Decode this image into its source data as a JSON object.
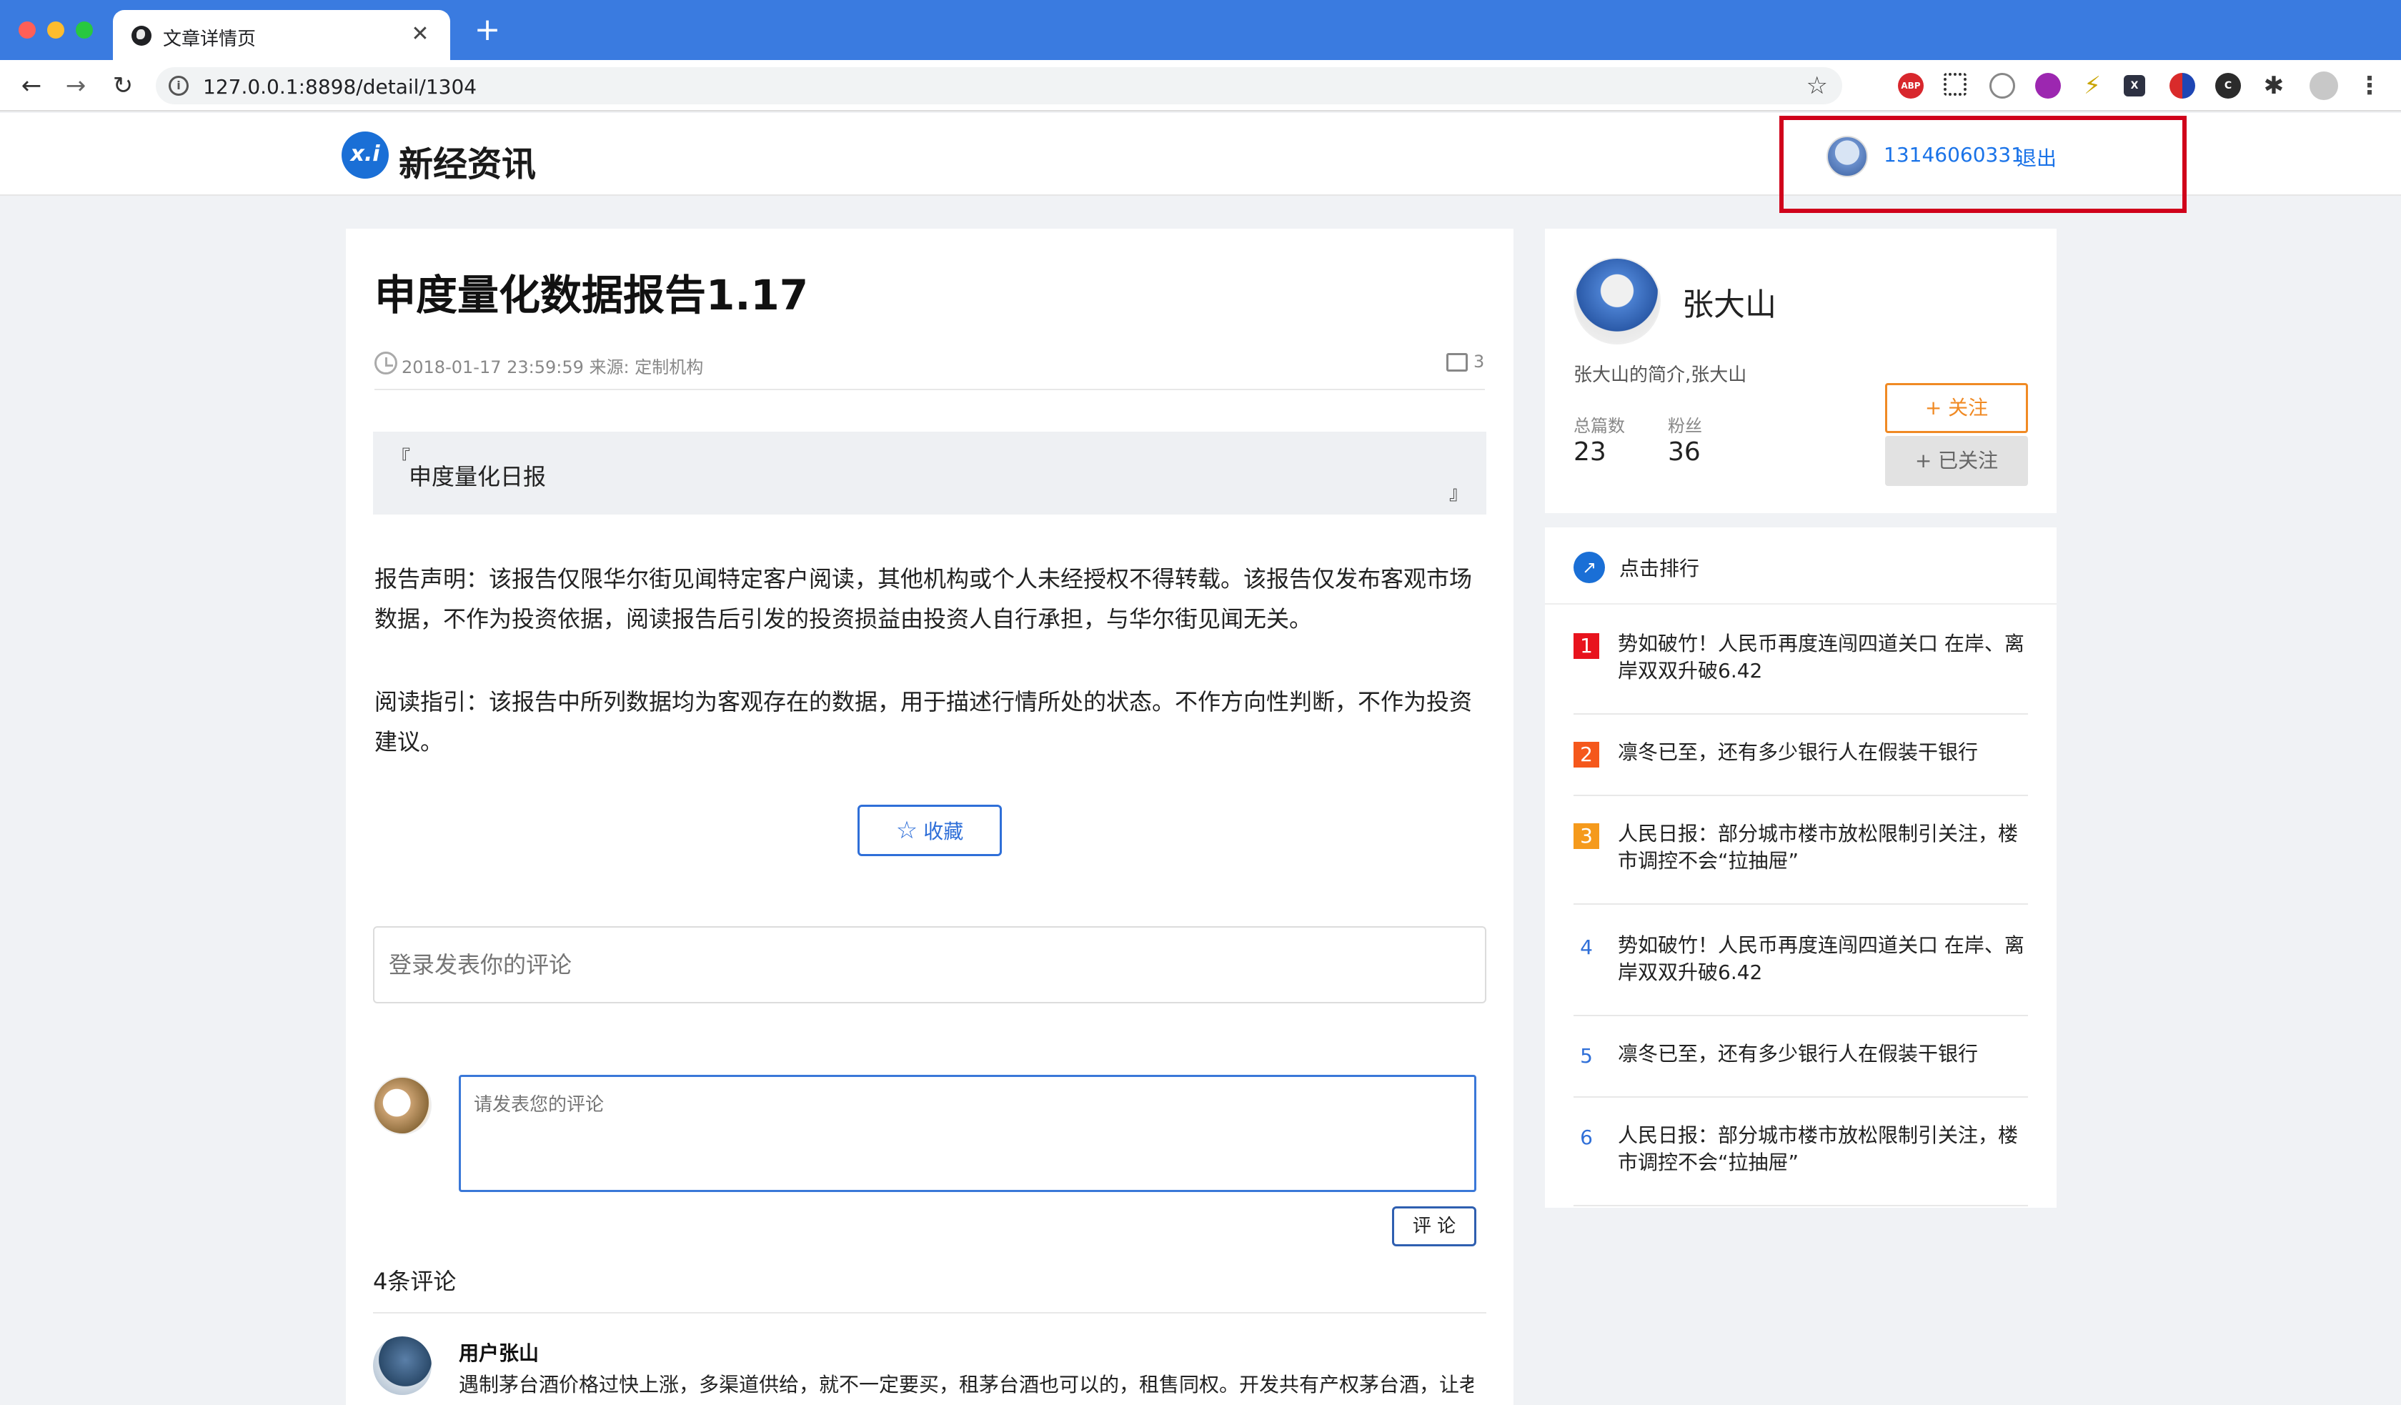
{
  "browser": {
    "tab_title": "文章详情页",
    "tab_close": "✕",
    "new_tab": "+",
    "url": "127.0.0.1:8898/detail/1304",
    "nav_back": "←",
    "nav_forward": "→",
    "nav_reload": "↻",
    "bookmark_star": "☆",
    "extensions": [
      {
        "name": "adblock-plus-icon",
        "label": "ABP"
      },
      {
        "name": "qr-code-icon",
        "label": ""
      },
      {
        "name": "globe-icon",
        "label": ""
      },
      {
        "name": "purple-extension-icon",
        "label": ""
      },
      {
        "name": "bolt-extension-icon",
        "label": "⚡"
      },
      {
        "name": "x-extension-icon",
        "label": "X"
      },
      {
        "name": "flag-extension-icon",
        "label": ""
      },
      {
        "name": "c-extension-icon",
        "label": "C"
      },
      {
        "name": "puzzle-icon",
        "label": "✱"
      },
      {
        "name": "profile-icon",
        "label": ""
      },
      {
        "name": "menu-kebab-icon",
        "label": "⋮"
      }
    ]
  },
  "site": {
    "logo_mark": "x.i",
    "logo_text": "新经资讯",
    "user_phone": "13146060331",
    "logout": "退出",
    "highlight_color": "#d0021b"
  },
  "article": {
    "title": "申度量化数据报告1.17",
    "date_source": "2018-01-17 23:59:59 来源: 定制机构",
    "comment_count": "3",
    "quote_open": "『",
    "quote_text": "申度量化日报",
    "quote_close": "』",
    "paragraphs": [
      "报告声明：该报告仅限华尔街见闻特定客户阅读，其他机构或个人未经授权不得转载。该报告仅发布客观市场数据，不作为投资依据，阅读报告后引发的投资损益由投资人自行承担，与华尔街见闻无关。",
      "阅读指引：该报告中所列数据均为客观存在的数据，用于描述行情所处的状态。不作方向性判断，不作为投资建议。"
    ],
    "favorite_icon": "☆",
    "favorite_label": "收藏",
    "login_comment_placeholder": "登录发表你的评论",
    "comment_placeholder": "请发表您的评论",
    "submit_label": "评 论",
    "comments_total": "4条评论",
    "comments": [
      {
        "user": "用户张山",
        "text": "遇制茅台酒价格过快上涨，多渠道供给，就不一定要买，租茅台酒也可以的，租售同权。开发共有产权茅台酒，让老"
      }
    ]
  },
  "author": {
    "name": "张大山",
    "bio": "张大山的简介,张大山",
    "stats": [
      {
        "label": "总篇数",
        "value": "23"
      },
      {
        "label": "粉丝",
        "value": "36"
      }
    ],
    "follow_label": "+ 关注",
    "followed_label": "+ 已关注"
  },
  "ranking": {
    "icon": "↗",
    "title": "点击排行",
    "items": [
      {
        "rank": "1",
        "text": "势如破竹！人民币再度连闯四道关口 在岸、离岸双双升破6.42"
      },
      {
        "rank": "2",
        "text": "凛冬已至，还有多少银行人在假装干银行"
      },
      {
        "rank": "3",
        "text": "人民日报：部分城市楼市放松限制引关注，楼市调控不会“拉抽屉”"
      },
      {
        "rank": "4",
        "text": "势如破竹！人民币再度连闯四道关口 在岸、离岸双双升破6.42"
      },
      {
        "rank": "5",
        "text": "凛冬已至，还有多少银行人在假装干银行"
      },
      {
        "rank": "6",
        "text": "人民日报：部分城市楼市放松限制引关注，楼市调控不会“拉抽屉”"
      }
    ]
  }
}
